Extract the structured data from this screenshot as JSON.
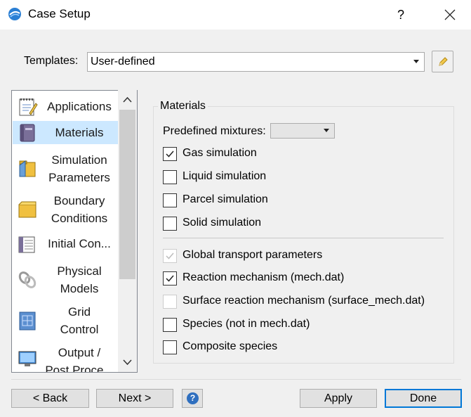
{
  "window": {
    "title": "Case Setup",
    "help": "?"
  },
  "templates": {
    "label": "Templates:",
    "value": "User-defined"
  },
  "nav": {
    "items": [
      {
        "lines": [
          "Applications"
        ],
        "icon": "notepad-icon",
        "selected": false
      },
      {
        "lines": [
          "Materials"
        ],
        "icon": "book-icon",
        "selected": true
      },
      {
        "lines": [
          "Simulation",
          "Parameters"
        ],
        "icon": "folder-settings-icon",
        "selected": false
      },
      {
        "lines": [
          "Boundary",
          "Conditions"
        ],
        "icon": "box-icon",
        "selected": false
      },
      {
        "lines": [
          "Initial Con..."
        ],
        "icon": "table-icon",
        "selected": false
      },
      {
        "lines": [
          "Physical",
          "Models"
        ],
        "icon": "link-icon",
        "selected": false
      },
      {
        "lines": [
          "Grid",
          "Control"
        ],
        "icon": "grid-icon",
        "selected": false
      },
      {
        "lines": [
          "Output /",
          "Post Proce..."
        ],
        "icon": "monitor-icon",
        "selected": false
      }
    ]
  },
  "materials": {
    "group_title": "Materials",
    "predefined_label": "Predefined mixtures:",
    "predefined_value": "",
    "checkboxes": [
      {
        "label": "Gas simulation",
        "checked": true,
        "enabled": true
      },
      {
        "label": "Liquid simulation",
        "checked": false,
        "enabled": true
      },
      {
        "label": "Parcel simulation",
        "checked": false,
        "enabled": true
      },
      {
        "label": "Solid simulation",
        "checked": false,
        "enabled": true
      },
      {
        "label": "Global transport parameters",
        "checked": true,
        "enabled": false
      },
      {
        "label": "Reaction mechanism (mech.dat)",
        "checked": true,
        "enabled": true
      },
      {
        "label": "Surface reaction mechanism (surface_mech.dat)",
        "checked": false,
        "enabled": false
      },
      {
        "label": "Species (not in mech.dat)",
        "checked": false,
        "enabled": true
      },
      {
        "label": "Composite species",
        "checked": false,
        "enabled": true
      }
    ]
  },
  "buttons": {
    "back": "< Back",
    "next": "Next >",
    "help": "?",
    "apply": "Apply",
    "done": "Done"
  },
  "colors": {
    "selection": "#cce8ff",
    "accent": "#0078d7",
    "background": "#f0f0f0"
  }
}
